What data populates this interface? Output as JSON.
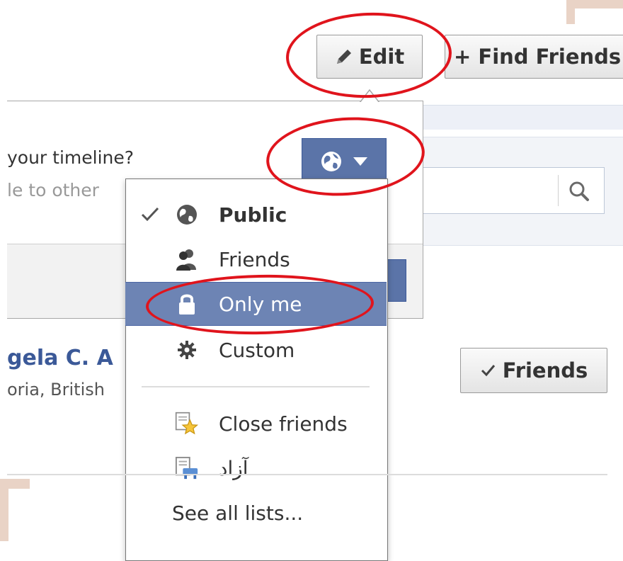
{
  "toolbar": {
    "edit_label": "Edit",
    "find_friends_label": "+ Find Friends"
  },
  "composer": {
    "question_text": "your timeline?",
    "hint_text": "le to other"
  },
  "privacy_menu": {
    "items": [
      {
        "label": "Public",
        "icon": "globe-icon",
        "selected": true
      },
      {
        "label": "Friends",
        "icon": "friends-icon"
      },
      {
        "label": "Only me",
        "icon": "lock-icon",
        "highlighted": true
      },
      {
        "label": "Custom",
        "icon": "gear-icon"
      },
      {
        "label": "Close friends",
        "icon": "star-list-icon"
      },
      {
        "label": "آزاد",
        "icon": "list-icon"
      },
      {
        "label": "See all lists..."
      }
    ]
  },
  "profile": {
    "name_text": "gela C. A",
    "location_text": "oria, British"
  },
  "friends_button": {
    "label": "Friends"
  },
  "colors": {
    "facebook_blue": "#3b5998",
    "menu_highlight": "#6d84b4",
    "annotation_red": "#e0141c"
  }
}
